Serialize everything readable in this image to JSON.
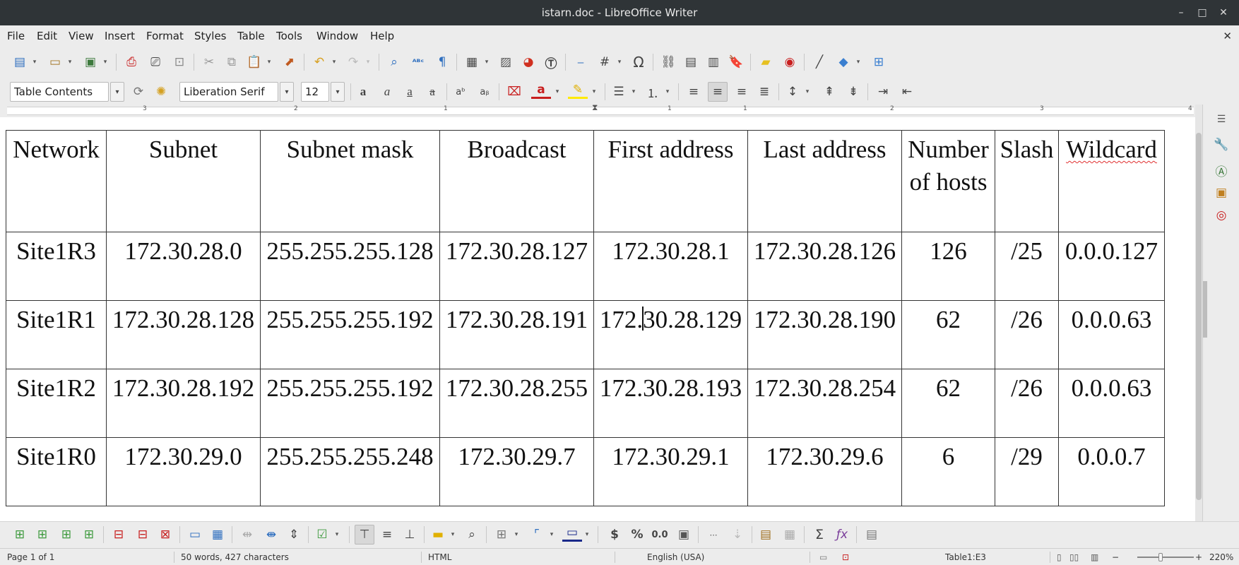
{
  "window": {
    "title": "istarn.doc - LibreOffice Writer",
    "minimize": "–",
    "maximize": "□",
    "close": "✕"
  },
  "menubar": {
    "items": [
      "File",
      "Edit",
      "View",
      "Insert",
      "Format",
      "Styles",
      "Table",
      "Tools",
      "Window",
      "Help"
    ],
    "doc_close": "✕"
  },
  "formatting": {
    "paragraph_style": "Table Contents",
    "font_name": "Liberation Serif",
    "font_size": "12"
  },
  "table": {
    "headers": [
      "Network",
      "Subnet",
      "Subnet mask",
      "Broadcast",
      "First address",
      "Last address",
      "Number of hosts",
      "Slash",
      "Wildcard"
    ],
    "rows": [
      [
        "Site1R3",
        "172.30.28.0",
        "255.255.255.128",
        "172.30.28.127",
        "172.30.28.1",
        "172.30.28.126",
        "126",
        "/25",
        "0.0.0.127"
      ],
      [
        "Site1R1",
        "172.30.28.128",
        "255.255.255.192",
        "172.30.28.191",
        "172.30.28.129",
        "172.30.28.190",
        "62",
        "/26",
        "0.0.0.63"
      ],
      [
        "Site1R2",
        "172.30.28.192",
        "255.255.255.192",
        "172.30.28.255",
        "172.30.28.193",
        "172.30.28.254",
        "62",
        "/26",
        "0.0.0.63"
      ],
      [
        "Site1R0",
        "172.30.29.0",
        "255.255.255.248",
        "172.30.29.7",
        "172.30.29.1",
        "172.30.29.6",
        "6",
        "/29",
        "0.0.0.7"
      ]
    ],
    "cursor_cell": {
      "row": 1,
      "col": 4,
      "before": "172.",
      "after": "30.28.129"
    }
  },
  "ruler": {
    "numbers": [
      "3",
      "2",
      "1",
      "1",
      "1",
      "2",
      "2",
      "3",
      "4"
    ]
  },
  "statusbar": {
    "page": "Page 1 of 1",
    "words": "50 words, 427 characters",
    "mode": "HTML",
    "language": "English (USA)",
    "cell": "Table1:E3",
    "zoom": "220%",
    "zoom_minus": "−",
    "zoom_plus": "+"
  },
  "colors": {
    "titlebar": "#2f3437",
    "accent_red": "#c81e1e",
    "accent_blue": "#1f5fbf",
    "highlight_yellow": "#ffea00"
  },
  "icons": {
    "toolbar1": [
      "new-icon",
      "open-icon",
      "save-icon",
      "export-pdf-icon",
      "print-icon",
      "print-preview-icon",
      "cut-icon",
      "copy-icon",
      "paste-icon",
      "clone-format-icon",
      "undo-icon",
      "redo-icon",
      "find-replace-icon",
      "spelling-icon",
      "formatting-marks-icon",
      "table-icon",
      "image-icon",
      "chart-icon",
      "textbox-icon",
      "page-break-icon",
      "field-icon",
      "special-character-icon",
      "hyperlink-icon",
      "footnote-icon",
      "endnote-icon",
      "bookmark-icon",
      "comment-icon",
      "track-changes-icon",
      "line-icon",
      "shapes-icon",
      "display-grid-icon"
    ],
    "sidebar": [
      "menu-icon",
      "properties-icon",
      "styles-icon",
      "gallery-icon",
      "navigator-icon"
    ]
  }
}
